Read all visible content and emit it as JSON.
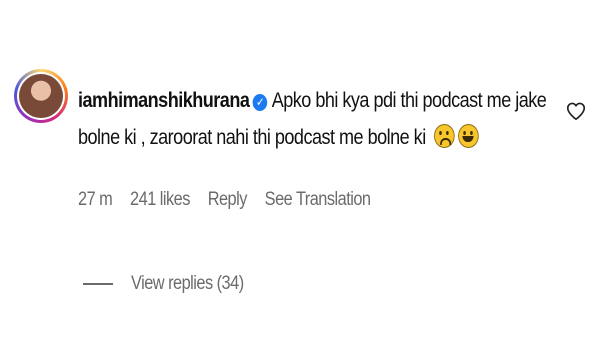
{
  "comment": {
    "username": "iamhimanshikhurana",
    "text_line1": "Apko bhi kya pdi thi podcast me jake",
    "text_line2": "bolne ki , zaroorat nahi thi podcast me bolne ki",
    "emojis": [
      "worried-face-icon",
      "laughing-tears-icon"
    ],
    "verified_glyph": "✓",
    "time": "27 m",
    "likes": "241 likes",
    "reply_label": "Reply",
    "translate_label": "See Translation",
    "view_replies_label": "View replies (34)"
  },
  "colors": {
    "verified": "#1d7bf0",
    "secondary_text": "#6b6b6b"
  }
}
